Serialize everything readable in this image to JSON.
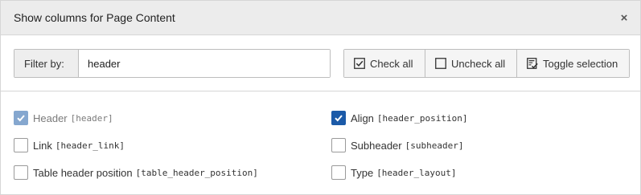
{
  "dialog": {
    "title": "Show columns for Page Content"
  },
  "filter": {
    "label": "Filter by:",
    "value": "header"
  },
  "actions": {
    "check_all": "Check all",
    "uncheck_all": "Uncheck all",
    "toggle_selection": "Toggle selection"
  },
  "columns": [
    {
      "label": "Header",
      "key": "[header]",
      "checked": true,
      "disabled": true
    },
    {
      "label": "Align",
      "key": "[header_position]",
      "checked": true,
      "disabled": false
    },
    {
      "label": "Link",
      "key": "[header_link]",
      "checked": false,
      "disabled": false
    },
    {
      "label": "Subheader",
      "key": "[subheader]",
      "checked": false,
      "disabled": false
    },
    {
      "label": "Table header position",
      "key": "[table_header_position]",
      "checked": false,
      "disabled": false
    },
    {
      "label": "Type",
      "key": "[header_layout]",
      "checked": false,
      "disabled": false
    }
  ],
  "colors": {
    "header_bg": "#ececec",
    "checkbox_checked": "#1b5aa8",
    "checkbox_disabled": "#85a7cf"
  }
}
